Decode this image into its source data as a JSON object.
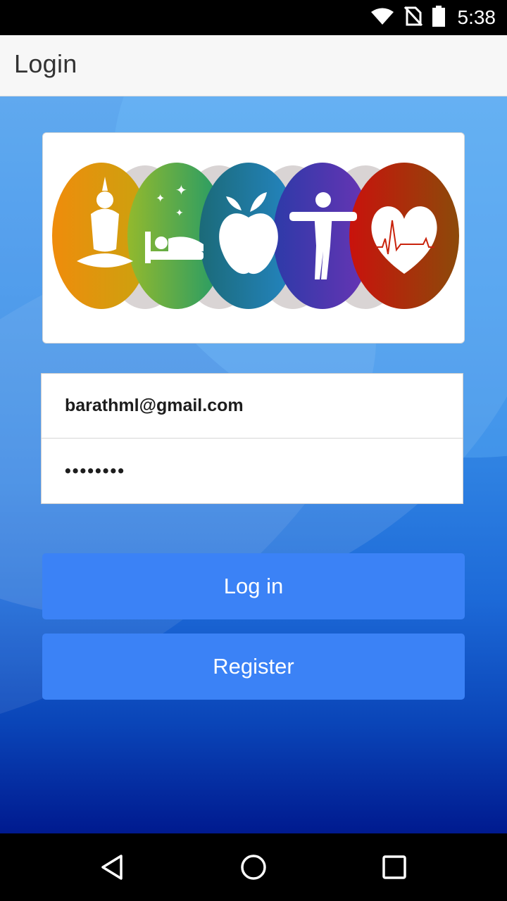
{
  "status_bar": {
    "time": "5:38",
    "icons": [
      "wifi-icon",
      "no-sim-icon",
      "battery-icon"
    ]
  },
  "app_bar": {
    "title": "Login"
  },
  "logo": {
    "icons": [
      "yoga-icon",
      "sleep-icon",
      "apple-icon",
      "body-icon",
      "heart-icon"
    ],
    "colors": [
      "#e8a012",
      "#5aa63b",
      "#1f7fa8",
      "#5a2fb0",
      "#d13f12"
    ]
  },
  "form": {
    "email_value": "barathml@gmail.com",
    "password_value": "••••••••"
  },
  "buttons": {
    "login_label": "Log in",
    "register_label": "Register"
  },
  "colors": {
    "button": "#3b82f6",
    "app_bar": "#f7f7f7"
  },
  "nav_bar": {
    "icons": [
      "back-icon",
      "home-icon",
      "recents-icon"
    ]
  }
}
